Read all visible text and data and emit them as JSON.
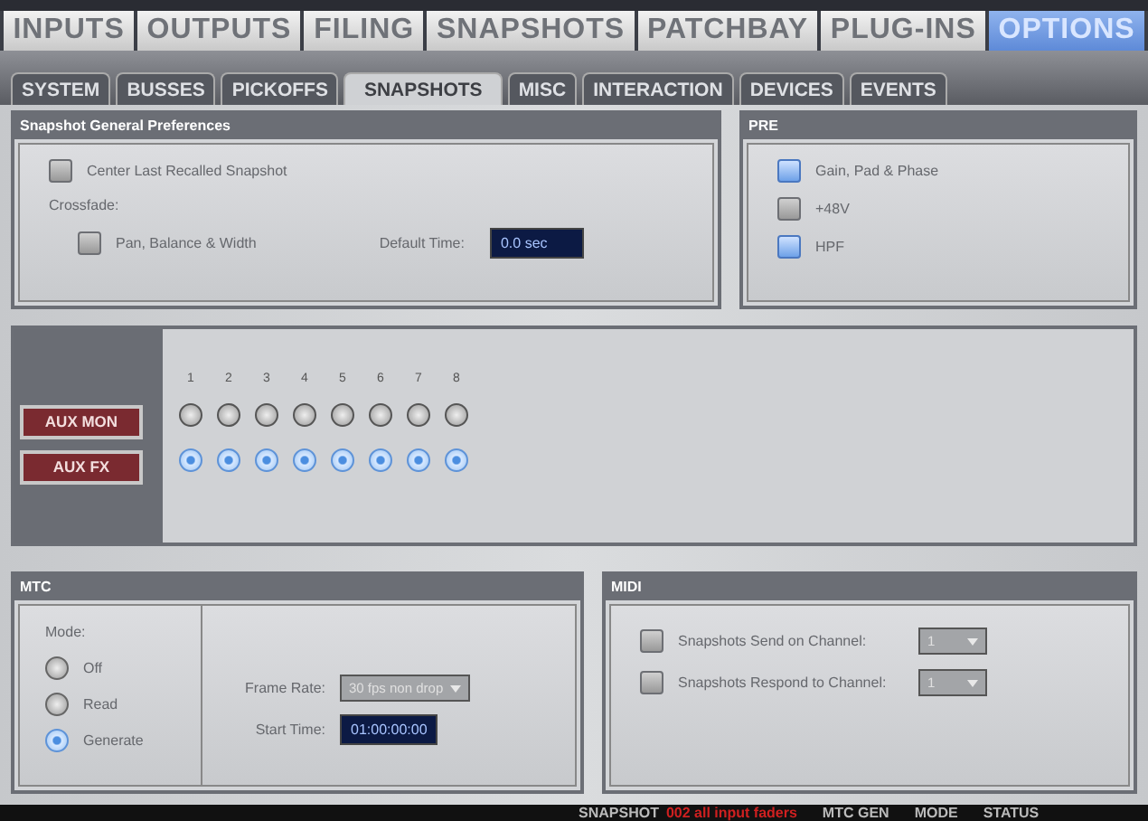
{
  "main_tabs": [
    {
      "label": "INPUTS",
      "selected": false
    },
    {
      "label": "OUTPUTS",
      "selected": false
    },
    {
      "label": "FILING",
      "selected": false
    },
    {
      "label": "SNAPSHOTS",
      "selected": false
    },
    {
      "label": "PATCHBAY",
      "selected": false
    },
    {
      "label": "PLUG-INS",
      "selected": false
    },
    {
      "label": "OPTIONS",
      "selected": true
    }
  ],
  "sub_tabs": [
    {
      "label": "SYSTEM",
      "selected": false
    },
    {
      "label": "BUSSES",
      "selected": false
    },
    {
      "label": "PICKOFFS",
      "selected": false
    },
    {
      "label": "SNAPSHOTS",
      "selected": true
    },
    {
      "label": "MISC",
      "selected": false
    },
    {
      "label": "INTERACTION",
      "selected": false
    },
    {
      "label": "DEVICES",
      "selected": false
    },
    {
      "label": "EVENTS",
      "selected": false
    }
  ],
  "general": {
    "title": "Snapshot General Preferences",
    "center_last": {
      "label": "Center Last Recalled Snapshot",
      "checked": false
    },
    "crossfade_label": "Crossfade:",
    "pan_balance": {
      "label": "Pan, Balance & Width",
      "checked": false
    },
    "default_time_label": "Default Time:",
    "default_time": "0.0 sec"
  },
  "pre": {
    "title": "PRE",
    "items": [
      {
        "label": "Gain, Pad & Phase",
        "checked": true
      },
      {
        "label": "+48V",
        "checked": false
      },
      {
        "label": "HPF",
        "checked": true
      }
    ]
  },
  "aux": {
    "numbers": [
      "1",
      "2",
      "3",
      "4",
      "5",
      "6",
      "7",
      "8"
    ],
    "rows": [
      {
        "label": "AUX MON",
        "buttons": [
          false,
          false,
          false,
          false,
          false,
          false,
          false,
          false
        ]
      },
      {
        "label": "AUX FX",
        "buttons": [
          true,
          true,
          true,
          true,
          true,
          true,
          true,
          true
        ]
      }
    ]
  },
  "mtc": {
    "title": "MTC",
    "mode_label": "Mode:",
    "modes": [
      {
        "label": "Off",
        "selected": false
      },
      {
        "label": "Read",
        "selected": false
      },
      {
        "label": "Generate",
        "selected": true
      }
    ],
    "frame_rate_label": "Frame Rate:",
    "frame_rate": "30 fps non drop",
    "start_time_label": "Start Time:",
    "start_time": "01:00:00:00"
  },
  "midi": {
    "title": "MIDI",
    "items": [
      {
        "label": "Snapshots Send on Channel:",
        "checked": false,
        "channel": "1"
      },
      {
        "label": "Snapshots Respond to Channel:",
        "checked": false,
        "channel": "1"
      }
    ]
  },
  "status_bar": [
    {
      "text": "SNAPSHOT",
      "kind": "label"
    },
    {
      "text": "002 all input faders",
      "kind": "alert"
    },
    {
      "text": "MTC GEN",
      "kind": "label"
    },
    {
      "text": "MODE",
      "kind": "label"
    },
    {
      "text": "STATUS",
      "kind": "label"
    }
  ]
}
